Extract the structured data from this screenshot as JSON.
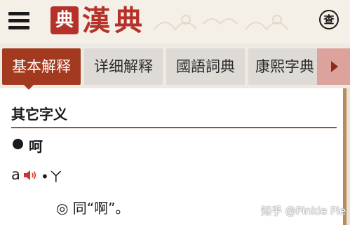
{
  "header": {
    "seal_char": "典",
    "logo_text": "漢典",
    "search_label": "查"
  },
  "tabs": [
    {
      "label": "基本解释",
      "active": true
    },
    {
      "label": "详细解释",
      "active": false
    },
    {
      "label": "國語詞典",
      "active": false
    },
    {
      "label": "康熙字典",
      "active": false
    }
  ],
  "content": {
    "section_title": "其它字义",
    "character": "呵",
    "pinyin": "a",
    "zhuyin": "•ㄚ",
    "definition": "◎ 同“啊”。"
  },
  "watermark": "知乎 @Pinkie Pie",
  "colors": {
    "accent": "#a33a1f",
    "brand_red": "#b5322a",
    "header_bg": "#f4efe7",
    "tab_bg": "#dedad6",
    "speaker_red": "#d0332a"
  }
}
